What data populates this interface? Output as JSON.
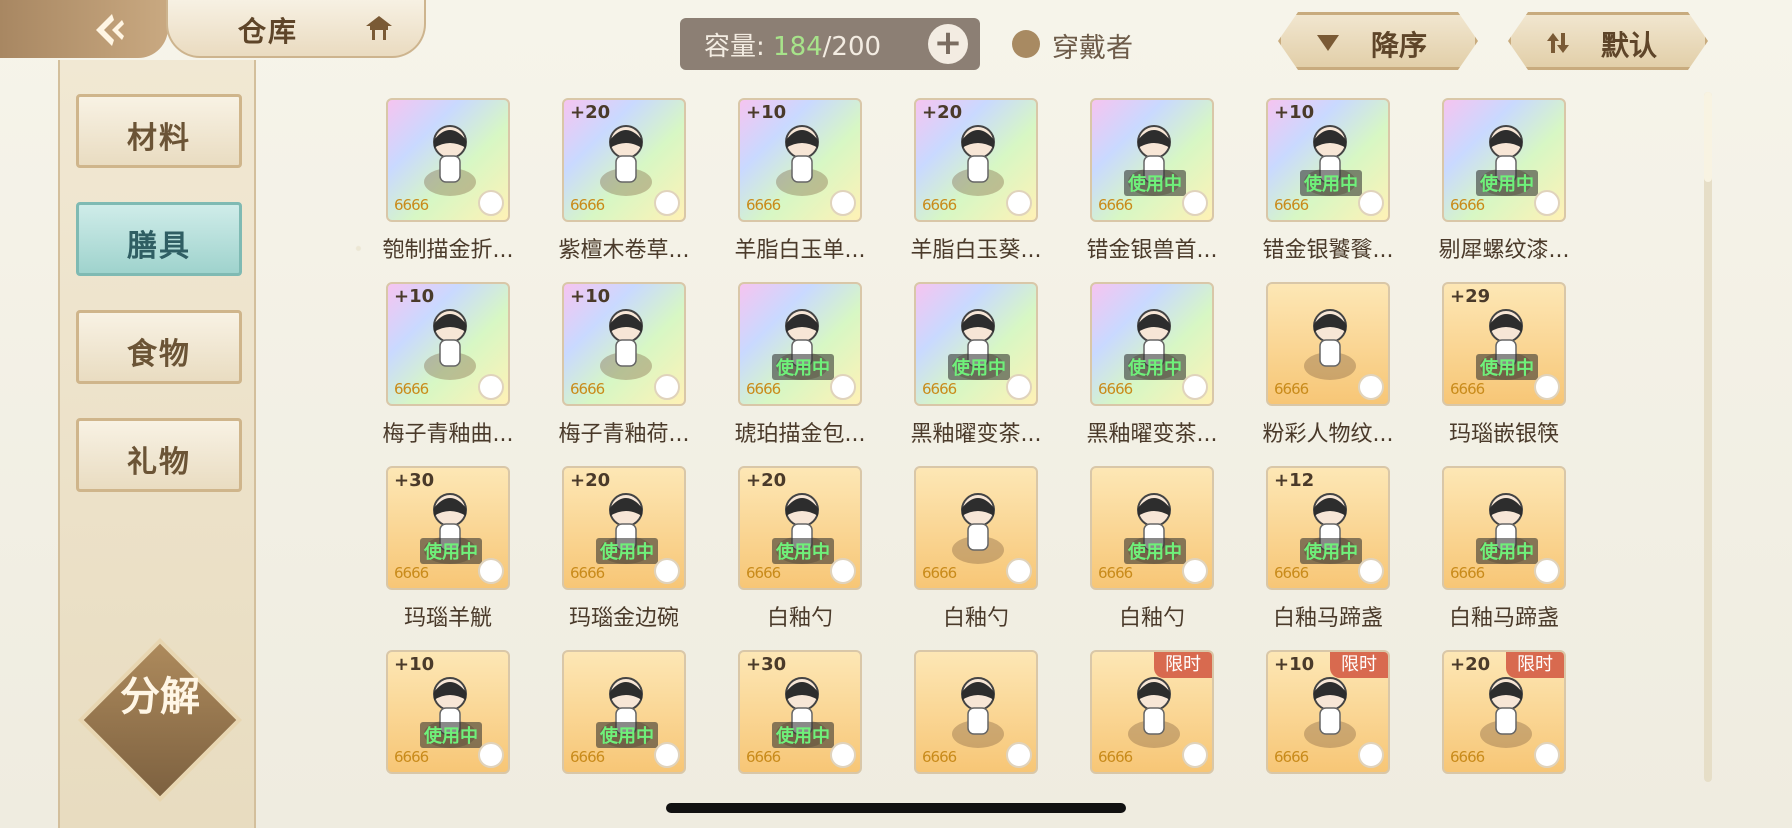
{
  "header": {
    "title": "仓库",
    "capacity_label": "容量:",
    "capacity_current": "184",
    "capacity_max": "/200",
    "capacity_add": "+",
    "wearer_filter": "穿戴者",
    "sort_desc": "降序",
    "sort_default": "默认"
  },
  "sidebar": {
    "items": [
      {
        "label": "材料",
        "active": false
      },
      {
        "label": "膳具",
        "active": true
      },
      {
        "label": "食物",
        "active": false
      },
      {
        "label": "礼物",
        "active": false
      }
    ],
    "decompose": "分解"
  },
  "inventory": {
    "inuse_label": "使用中",
    "limited_label": "限时",
    "stars": "6666",
    "rows": [
      [
        {
          "name": "匏制描金折...",
          "plus": "",
          "rarity": "rainbow",
          "inuse": false,
          "limited": false
        },
        {
          "name": "紫檀木卷草...",
          "plus": "+20",
          "rarity": "rainbow",
          "inuse": false,
          "limited": false
        },
        {
          "name": "羊脂白玉单...",
          "plus": "+10",
          "rarity": "rainbow",
          "inuse": false,
          "limited": false
        },
        {
          "name": "羊脂白玉葵...",
          "plus": "+20",
          "rarity": "rainbow",
          "inuse": false,
          "limited": false
        },
        {
          "name": "错金银兽首...",
          "plus": "",
          "rarity": "rainbow",
          "inuse": true,
          "limited": false
        },
        {
          "name": "错金银饕餮...",
          "plus": "+10",
          "rarity": "rainbow",
          "inuse": true,
          "limited": false
        },
        {
          "name": "剔犀螺纹漆...",
          "plus": "",
          "rarity": "rainbow",
          "inuse": true,
          "limited": false
        }
      ],
      [
        {
          "name": "梅子青釉曲...",
          "plus": "+10",
          "rarity": "rainbow",
          "inuse": false,
          "limited": false
        },
        {
          "name": "梅子青釉荷...",
          "plus": "+10",
          "rarity": "rainbow",
          "inuse": false,
          "limited": false
        },
        {
          "name": "琥珀描金包...",
          "plus": "",
          "rarity": "rainbow",
          "inuse": true,
          "limited": false
        },
        {
          "name": "黑釉曜变茶...",
          "plus": "",
          "rarity": "rainbow",
          "inuse": true,
          "limited": false
        },
        {
          "name": "黑釉曜变茶...",
          "plus": "",
          "rarity": "rainbow",
          "inuse": true,
          "limited": false
        },
        {
          "name": "粉彩人物纹...",
          "plus": "",
          "rarity": "gold",
          "inuse": false,
          "limited": false
        },
        {
          "name": "玛瑙嵌银筷",
          "plus": "+29",
          "rarity": "gold",
          "inuse": true,
          "limited": false
        }
      ],
      [
        {
          "name": "玛瑙羊觥",
          "plus": "+30",
          "rarity": "gold",
          "inuse": true,
          "limited": false
        },
        {
          "name": "玛瑙金边碗",
          "plus": "+20",
          "rarity": "gold",
          "inuse": true,
          "limited": false
        },
        {
          "name": "白釉勺",
          "plus": "+20",
          "rarity": "gold",
          "inuse": true,
          "limited": false
        },
        {
          "name": "白釉勺",
          "plus": "",
          "rarity": "gold",
          "inuse": false,
          "limited": false
        },
        {
          "name": "白釉勺",
          "plus": "",
          "rarity": "gold",
          "inuse": true,
          "limited": false
        },
        {
          "name": "白釉马蹄盏",
          "plus": "+12",
          "rarity": "gold",
          "inuse": true,
          "limited": false
        },
        {
          "name": "白釉马蹄盏",
          "plus": "",
          "rarity": "gold",
          "inuse": true,
          "limited": false
        }
      ],
      [
        {
          "name": "",
          "plus": "+10",
          "rarity": "gold",
          "inuse": true,
          "limited": false
        },
        {
          "name": "",
          "plus": "",
          "rarity": "gold",
          "inuse": true,
          "limited": false
        },
        {
          "name": "",
          "plus": "+30",
          "rarity": "gold",
          "inuse": true,
          "limited": false
        },
        {
          "name": "",
          "plus": "",
          "rarity": "gold",
          "inuse": false,
          "limited": false
        },
        {
          "name": "",
          "plus": "",
          "rarity": "gold",
          "inuse": false,
          "limited": true
        },
        {
          "name": "",
          "plus": "+10",
          "rarity": "gold",
          "inuse": false,
          "limited": true
        },
        {
          "name": "",
          "plus": "+20",
          "rarity": "gold",
          "inuse": false,
          "limited": true
        }
      ]
    ]
  },
  "icons": {
    "back": "back-arrow-icon",
    "title_deco": "pavilion-icon",
    "sort_desc": "triangle-down-icon",
    "sort_default": "sort-arrows-icon"
  },
  "colors": {
    "accent_teal": "#9fd3cd",
    "inuse_green": "#6ff07a",
    "limited_red": "#d86a4f",
    "capacity_green": "#a7e38a"
  }
}
